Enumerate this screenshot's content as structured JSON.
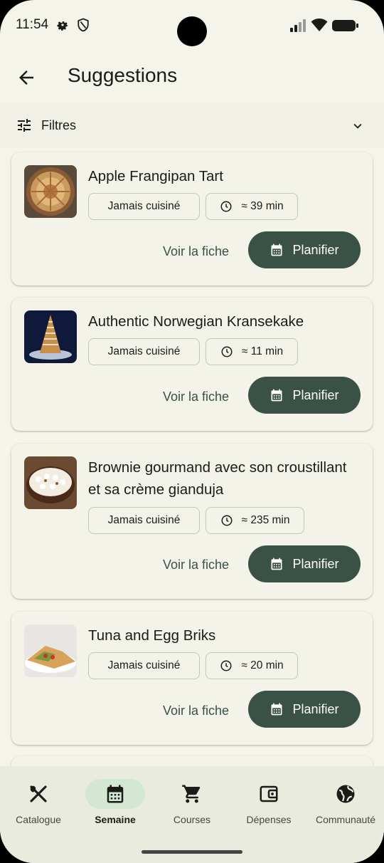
{
  "status_bar": {
    "time": "11:54"
  },
  "header": {
    "title": "Suggestions"
  },
  "filters": {
    "label": "Filtres"
  },
  "recipes": [
    {
      "title": "Apple Frangipan Tart",
      "status": "Jamais cuisiné",
      "duration": "≈ 39 min",
      "view_label": "Voir la fiche",
      "plan_label": "Planifier"
    },
    {
      "title": "Authentic Norwegian Kransekake",
      "status": "Jamais cuisiné",
      "duration": "≈ 11 min",
      "view_label": "Voir la fiche",
      "plan_label": "Planifier"
    },
    {
      "title": "Brownie gourmand avec son croustillant et sa crème gianduja",
      "status": "Jamais cuisiné",
      "duration": "≈ 235 min",
      "view_label": "Voir la fiche",
      "plan_label": "Planifier"
    },
    {
      "title": "Tuna and Egg Briks",
      "status": "Jamais cuisiné",
      "duration": "≈ 20 min",
      "view_label": "Voir la fiche",
      "plan_label": "Planifier"
    }
  ],
  "bottom_nav": {
    "items": [
      {
        "label": "Catalogue",
        "icon": "utensils-icon"
      },
      {
        "label": "Semaine",
        "icon": "calendar-icon",
        "active": true
      },
      {
        "label": "Courses",
        "icon": "cart-icon"
      },
      {
        "label": "Dépenses",
        "icon": "wallet-icon"
      },
      {
        "label": "Communauté",
        "icon": "globe-icon"
      }
    ]
  },
  "colors": {
    "primary": "#3A5145",
    "background": "#F4F4EA",
    "nav_pill": "#D3E7D2",
    "chip_border": "#C2C8BC"
  }
}
